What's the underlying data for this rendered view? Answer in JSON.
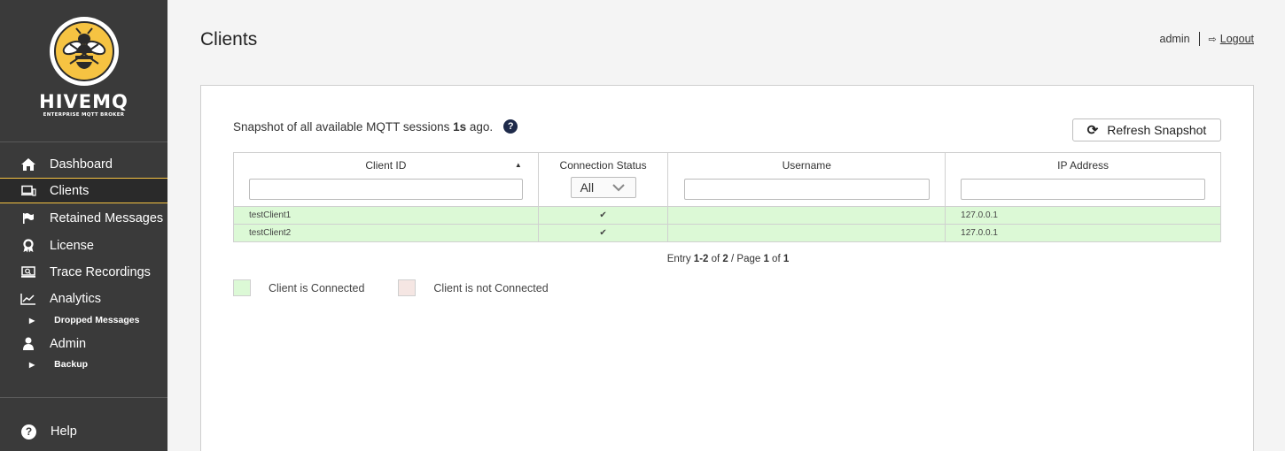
{
  "brand": {
    "name": "HIVEMQ",
    "subtitle": "ENTERPRISE MQTT BROKER",
    "accent": "#f6c342"
  },
  "sidebar": {
    "items": [
      {
        "label": "Dashboard",
        "icon": "home-icon"
      },
      {
        "label": "Clients",
        "icon": "laptop-icon",
        "active": true
      },
      {
        "label": "Retained Messages",
        "icon": "flag-icon"
      },
      {
        "label": "License",
        "icon": "award-icon"
      },
      {
        "label": "Trace Recordings",
        "icon": "record-icon"
      },
      {
        "label": "Analytics",
        "icon": "line-chart-icon"
      },
      {
        "label": "Admin",
        "icon": "user-icon"
      }
    ],
    "sub_items": {
      "analytics": "Dropped Messages",
      "admin": "Backup"
    },
    "help": "Help"
  },
  "header": {
    "title": "Clients",
    "user": "admin",
    "logout": "Logout"
  },
  "panel": {
    "snapshot_prefix": "Snapshot of all available MQTT sessions ",
    "snapshot_age": "1s",
    "snapshot_suffix": " ago.",
    "refresh_label": "Refresh Snapshot"
  },
  "table": {
    "columns": [
      "Client ID",
      "Connection Status",
      "Username",
      "IP Address"
    ],
    "status_filter": "All",
    "filters": {
      "client_id": "",
      "username": "",
      "ip": ""
    },
    "rows": [
      {
        "client_id": "testClient1",
        "connected": "✔",
        "username": "",
        "ip": "127.0.0.1"
      },
      {
        "client_id": "testClient2",
        "connected": "✔",
        "username": "",
        "ip": "127.0.0.1"
      }
    ]
  },
  "pagination": {
    "entry_label": "Entry ",
    "range": "1-2",
    "of": " of ",
    "total": "2",
    "page_label": " / Page ",
    "page": "1",
    "page_of": " of ",
    "pages": "1"
  },
  "legend": {
    "connected": "Client is Connected",
    "not_connected": "Client is not Connected",
    "connected_color": "#dcf9d6",
    "not_connected_color": "#f5e6e3"
  }
}
